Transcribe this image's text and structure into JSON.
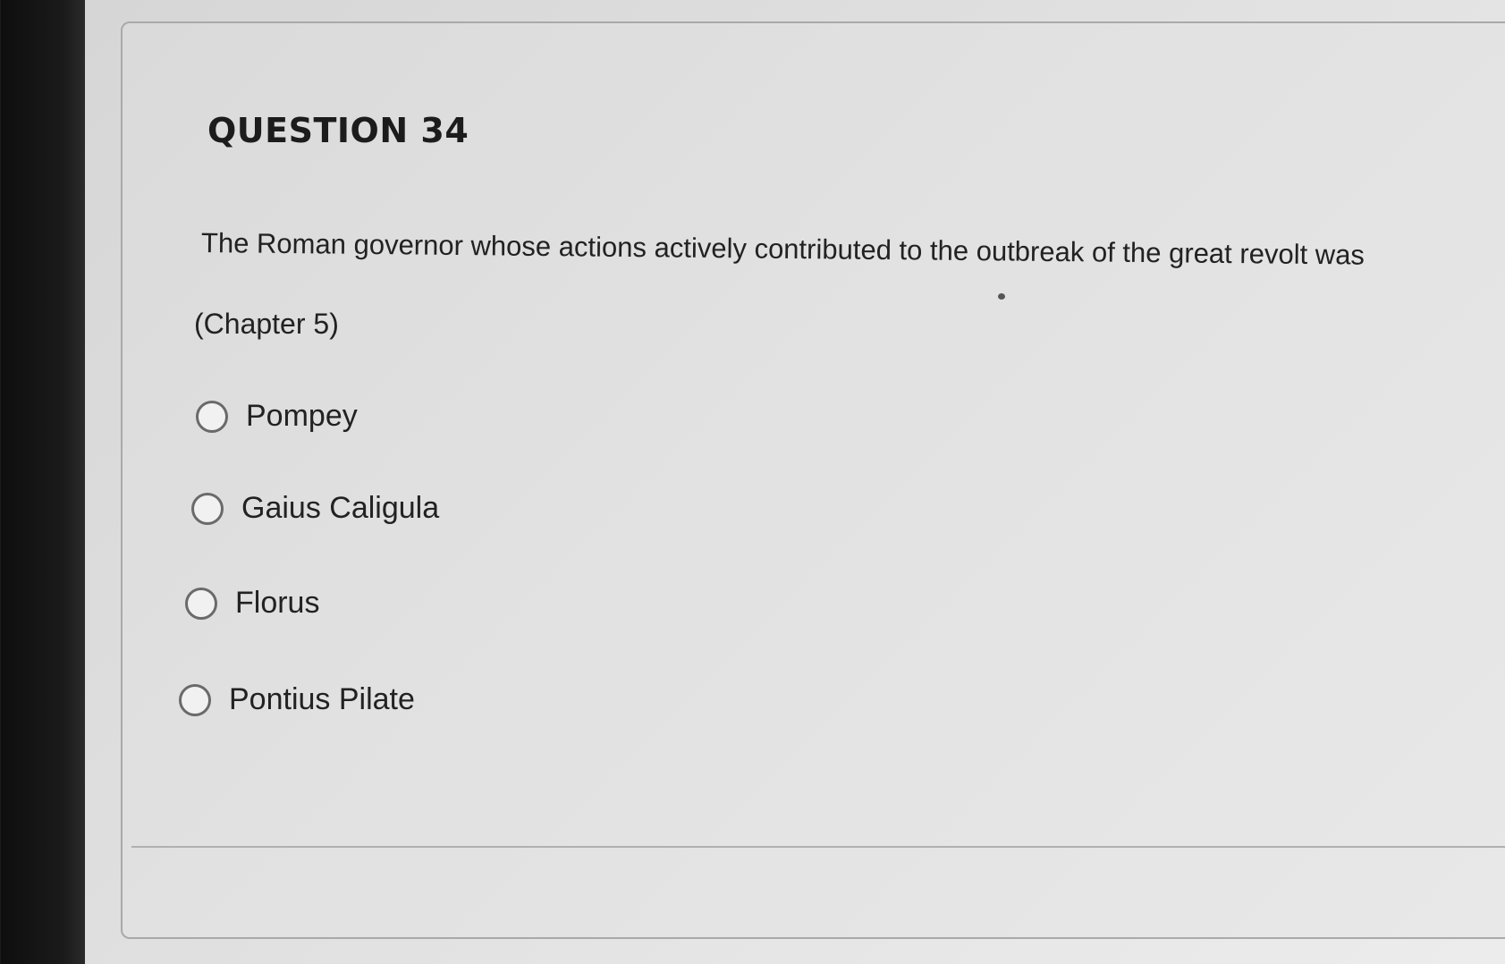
{
  "question": {
    "title": "QUESTION 34",
    "text": "The Roman governor whose actions actively contributed to the outbreak of the great revolt was",
    "chapter": "(Chapter 5)",
    "options": [
      {
        "label": "Pompey",
        "selected": false
      },
      {
        "label": "Gaius Caligula",
        "selected": false
      },
      {
        "label": "Florus",
        "selected": false
      },
      {
        "label": "Pontius Pilate",
        "selected": false
      }
    ]
  }
}
